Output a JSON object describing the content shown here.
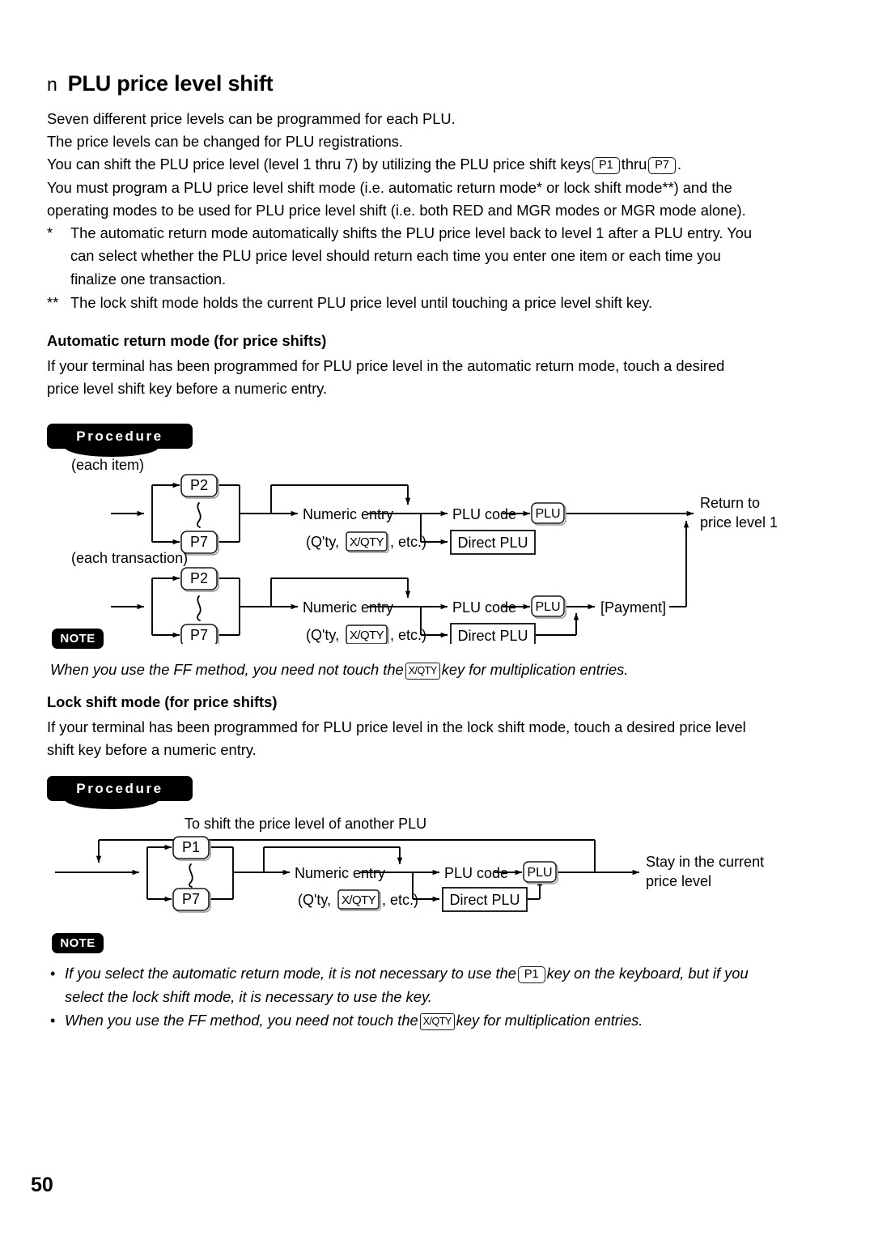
{
  "page": {
    "number": "50",
    "heading_bullet": "n",
    "heading": "PLU price level shift"
  },
  "intro": {
    "lines": [
      "Seven different price levels can be programmed for each PLU.",
      "The price levels can be changed for PLU registrations."
    ],
    "line3_a": "You can shift the PLU price level (level 1 thru 7) by utilizing the PLU price shift keys",
    "line3_key1": "P1",
    "line3_b": "thru",
    "line3_key2": "P7",
    "line3_c": ".",
    "line4": "You must program a PLU price level shift mode (i.e. automatic return mode* or lock shift mode**) and the",
    "line5": "operating modes to be used for PLU price level shift (i.e. both RED and MGR modes or MGR mode alone).",
    "footnote1_marker": "*",
    "footnote1_lines": [
      "The automatic return mode automatically shifts the PLU price level back to level 1 after a PLU entry.  You",
      "can select whether the PLU price level should return each time you enter one item or each time you",
      "finalize one transaction."
    ],
    "footnote2_marker": "**",
    "footnote2_lines": [
      "The lock shift mode holds the current PLU price level until touching a price level shift key."
    ]
  },
  "auto_return": {
    "subhead": "Automatic return mode (for price shifts)",
    "lines": [
      "If your terminal has been programmed for PLU price level in the automatic return mode, touch a desired",
      "price level shift key before a numeric entry."
    ],
    "procedure_label": "Procedure"
  },
  "diagram1": {
    "row1_caption": "(each item)",
    "row2_caption": "(each transaction)",
    "key_top": "P2",
    "key_bottom": "P7",
    "numeric_entry": "Numeric entry",
    "qty_prefix": "(Q'ty,",
    "qty_key": "X/QTY",
    "qty_suffix": ", etc.)",
    "plu_code": "PLU code",
    "plu_key": "PLU",
    "direct_plu": "Direct PLU",
    "payment": "[Payment]",
    "result_line1": "Return to",
    "result_line2": "price level 1"
  },
  "note1": {
    "badge": "NOTE",
    "text_a": "When you use the FF method, you need not touch the",
    "key": "X/QTY",
    "text_b": "key for multiplication entries."
  },
  "lock_shift": {
    "subhead": "Lock shift mode (for price shifts)",
    "lines": [
      "If your terminal has been programmed for PLU price level in the lock shift mode, touch a desired price level",
      "shift key before a numeric entry."
    ],
    "procedure_label": "Procedure"
  },
  "diagram2": {
    "loop_caption": "To shift the price level of another PLU",
    "key_top": "P1",
    "key_bottom": "P7",
    "numeric_entry": "Numeric entry",
    "qty_prefix": "(Q'ty,",
    "qty_key": "X/QTY",
    "qty_suffix": ", etc.)",
    "plu_code": "PLU code",
    "plu_key": "PLU",
    "direct_plu": "Direct PLU",
    "result_line1": "Stay in the current",
    "result_line2": "price level"
  },
  "note2": {
    "badge": "NOTE",
    "bullet1_a": "If you select the automatic return mode, it is not necessary to use the",
    "bullet1_key": "P1",
    "bullet1_b": "key on the keyboard, but if you",
    "bullet1_line2": "select the lock shift mode, it is necessary to use the key.",
    "bullet2_a": "When you use the FF method, you need not touch the",
    "bullet2_key": "X/QTY",
    "bullet2_b": "key for multiplication entries.",
    "dot": "•"
  }
}
